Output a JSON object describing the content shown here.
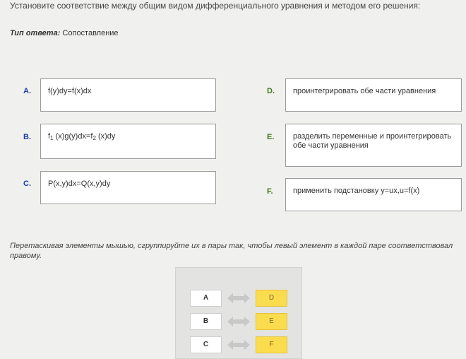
{
  "question": "Установите соответствие между общим видом дифференциального уравнения и методом его решения:",
  "answer_type": {
    "label": "Тип ответа:",
    "value": "Сопоставление"
  },
  "left_items": [
    {
      "letter": "A.",
      "parts": {
        "p1": "f(y)dy=f(x)dx"
      }
    },
    {
      "letter": "B.",
      "parts": {
        "p1": "f",
        "s1": "1",
        "p2": " (x)g(y)dx=f",
        "s2": "2",
        "p3": " (x)dy"
      }
    },
    {
      "letter": "C.",
      "parts": {
        "p1": "P(x,y)dx=Q(x,y)dy"
      }
    }
  ],
  "right_items": [
    {
      "letter": "D.",
      "text": "проинтегрировать обе части уравнения"
    },
    {
      "letter": "E.",
      "text": "разделить переменные и проинтегрировать обе части уравнения"
    },
    {
      "letter": "F.",
      "text": "применить подстановку y=ux,u=f(x)"
    }
  ],
  "instructions": "Перетаскивая элементы мышью, сгруппируйте их в пары так, чтобы левый элемент в каждой паре соответствовал правому.",
  "pairs": [
    {
      "left": "A",
      "right": "D"
    },
    {
      "left": "B",
      "right": "E"
    },
    {
      "left": "C",
      "right": "F"
    }
  ],
  "colors": {
    "left_letter": "#1c3da8",
    "right_letter": "#3d7a17",
    "chip_right": "#fadc4e",
    "arrow": "#c8c8c8"
  },
  "icons": {
    "pair_arrow": "double-arrow-icon"
  }
}
